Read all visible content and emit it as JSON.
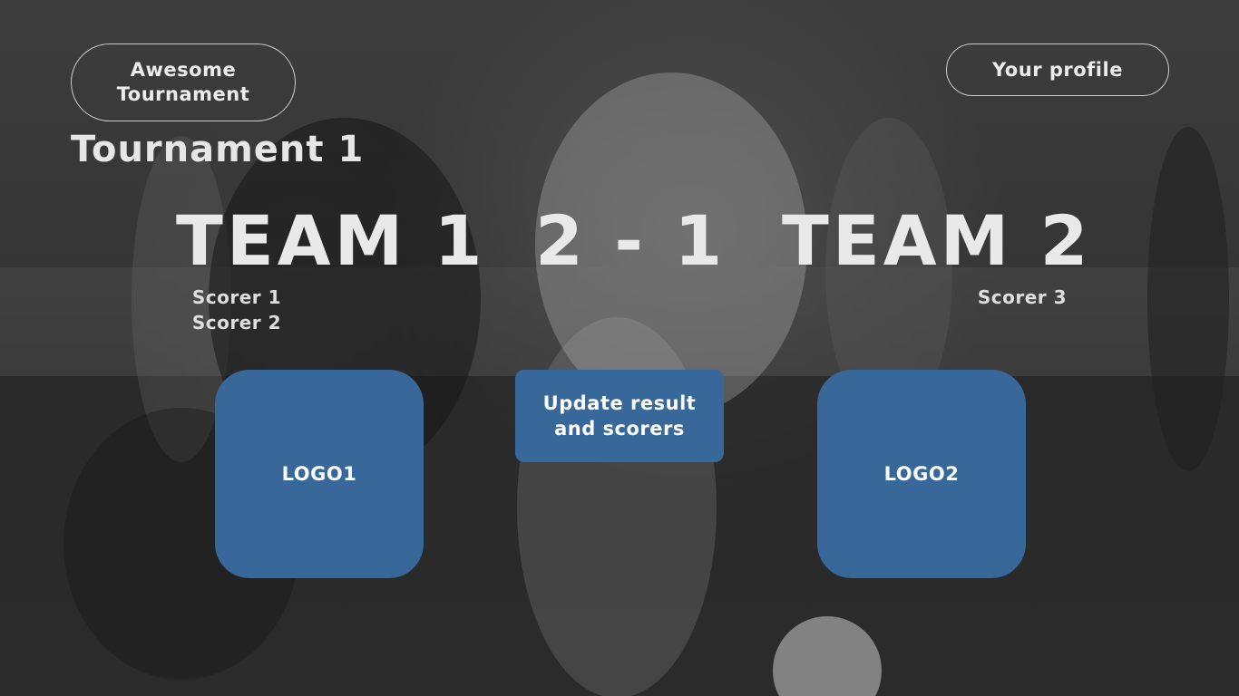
{
  "header": {
    "brand_label": "Awesome Tournament",
    "profile_label": "Your profile"
  },
  "tournament": {
    "title": "Tournament 1"
  },
  "match": {
    "home_team": "TEAM 1",
    "away_team": "TEAM 2",
    "score_text": "2 - 1",
    "home_scorers": [
      "Scorer 1",
      "Scorer 2"
    ],
    "away_scorers": [
      "Scorer 3"
    ],
    "home_logo_label": "LOGO1",
    "away_logo_label": "LOGO2"
  },
  "actions": {
    "update_label": "Update result and scorers"
  },
  "colors": {
    "accent": "#386799",
    "text": "#e9e9e9"
  }
}
